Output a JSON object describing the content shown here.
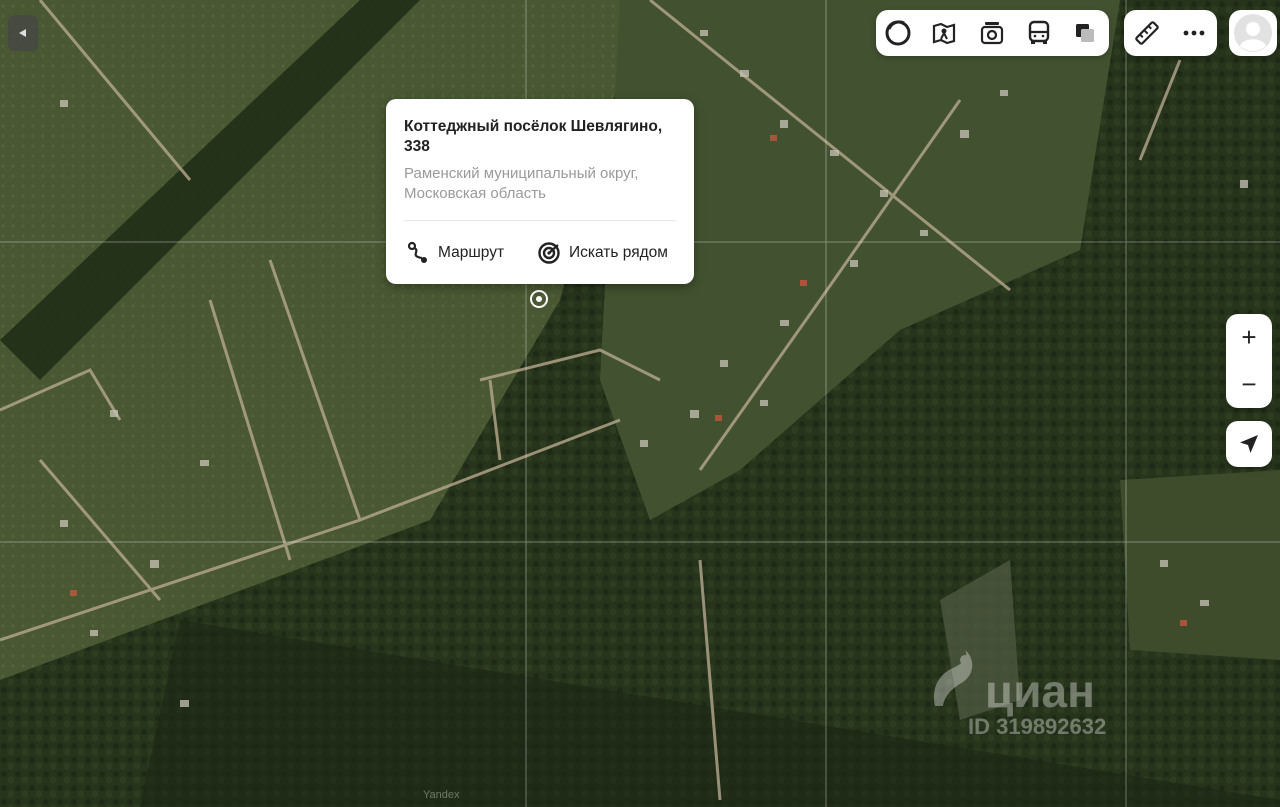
{
  "popup": {
    "title": "Коттеджный посёлок Шевлягино, 338",
    "subtitle": "Раменский муниципальный округ, Московская область",
    "route_label": "Маршрут",
    "nearby_label": "Искать рядом"
  },
  "toolbar": {
    "icons": [
      "layers-icon",
      "panorama-icon",
      "photo-icon",
      "transport-icon",
      "map-style-icon"
    ],
    "tools": [
      "ruler-icon",
      "more-icon"
    ]
  },
  "zoom": {
    "plus": "+",
    "minus": "−"
  },
  "watermark": {
    "brand": "циан",
    "id": "ID 319892632",
    "yandex": "Yandex"
  },
  "colors": {
    "accent": "#222222",
    "subtitle": "#9a9a9a"
  }
}
